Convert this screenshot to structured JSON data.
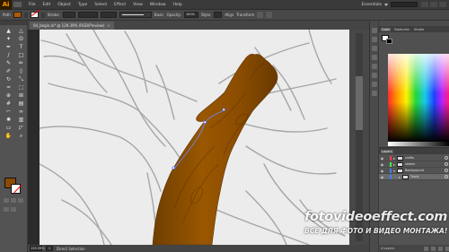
{
  "app": {
    "logo": "Ai",
    "accent": "#ff9a00"
  },
  "menu": [
    "File",
    "Edit",
    "Object",
    "Type",
    "Select",
    "Effect",
    "View",
    "Window",
    "Help"
  ],
  "workspace": {
    "label": "Essentials"
  },
  "control_bar": {
    "selection_label": "Path",
    "stroke_label": "Stroke:",
    "stroke_preview_label": "Basic",
    "opacity_label": "Opacity:",
    "opacity_value": "100%",
    "style_label": "Style:",
    "align_label": "Align",
    "transform_label": "Transform",
    "fill_color": "#b05a00"
  },
  "document": {
    "tab_title": "04_begin.ai* @ 129.39% (RGB/Preview)",
    "close": "×"
  },
  "status_bar": {
    "zoom": "129.39%",
    "page": "1",
    "tool": "Direct Selection"
  },
  "tools": [
    {
      "name": "selection-tool",
      "glyph": "▲"
    },
    {
      "name": "direct-selection-tool",
      "glyph": "△"
    },
    {
      "name": "magic-wand-tool",
      "glyph": "✦"
    },
    {
      "name": "lasso-tool",
      "glyph": "ʘ"
    },
    {
      "name": "pen-tool",
      "glyph": "✒"
    },
    {
      "name": "type-tool",
      "glyph": "T"
    },
    {
      "name": "line-tool",
      "glyph": "/"
    },
    {
      "name": "rectangle-tool",
      "glyph": "□"
    },
    {
      "name": "paintbrush-tool",
      "glyph": "✎"
    },
    {
      "name": "pencil-tool",
      "glyph": "✏"
    },
    {
      "name": "blob-brush-tool",
      "glyph": "✐"
    },
    {
      "name": "eraser-tool",
      "glyph": "◊"
    },
    {
      "name": "rotate-tool",
      "glyph": "↻"
    },
    {
      "name": "scale-tool",
      "glyph": "⤡"
    },
    {
      "name": "width-tool",
      "glyph": "≈"
    },
    {
      "name": "free-transform-tool",
      "glyph": "⬚"
    },
    {
      "name": "shape-builder-tool",
      "glyph": "⊕"
    },
    {
      "name": "perspective-grid-tool",
      "glyph": "⊞"
    },
    {
      "name": "mesh-tool",
      "glyph": "#"
    },
    {
      "name": "gradient-tool",
      "glyph": "▤"
    },
    {
      "name": "eyedropper-tool",
      "glyph": "⌐"
    },
    {
      "name": "blend-tool",
      "glyph": "∞"
    },
    {
      "name": "symbol-sprayer-tool",
      "glyph": "✺"
    },
    {
      "name": "column-graph-tool",
      "glyph": "▥"
    },
    {
      "name": "artboard-tool",
      "glyph": "▭"
    },
    {
      "name": "slice-tool",
      "glyph": "◸"
    },
    {
      "name": "hand-tool",
      "glyph": "✋"
    },
    {
      "name": "zoom-tool",
      "glyph": "⌕"
    }
  ],
  "fill_stroke": {
    "fill": "#8a4a00",
    "stroke": "#ffffff"
  },
  "color_panel": {
    "tabs": [
      "Color",
      "Swatches",
      "Stroke"
    ],
    "active_tab": 0
  },
  "layers_panel": {
    "tab": "Layers",
    "layers": [
      {
        "name": "crafts",
        "chip": "#ff4040",
        "expanded": false,
        "selected": false
      },
      {
        "name": "sketch",
        "chip": "#40ff40",
        "expanded": false,
        "selected": false
      },
      {
        "name": "Background",
        "chip": "#4080ff",
        "expanded": true,
        "selected": false
      },
      {
        "name": "Trunk",
        "chip": "#4080ff",
        "expanded": false,
        "selected": true
      }
    ],
    "footer": "4 Layers"
  },
  "watermark": {
    "line1": "fotovideoeffect.com",
    "line2": "ВСЕ ДЛЯ ФОТО И ВИДЕО МОНТАЖА!"
  }
}
